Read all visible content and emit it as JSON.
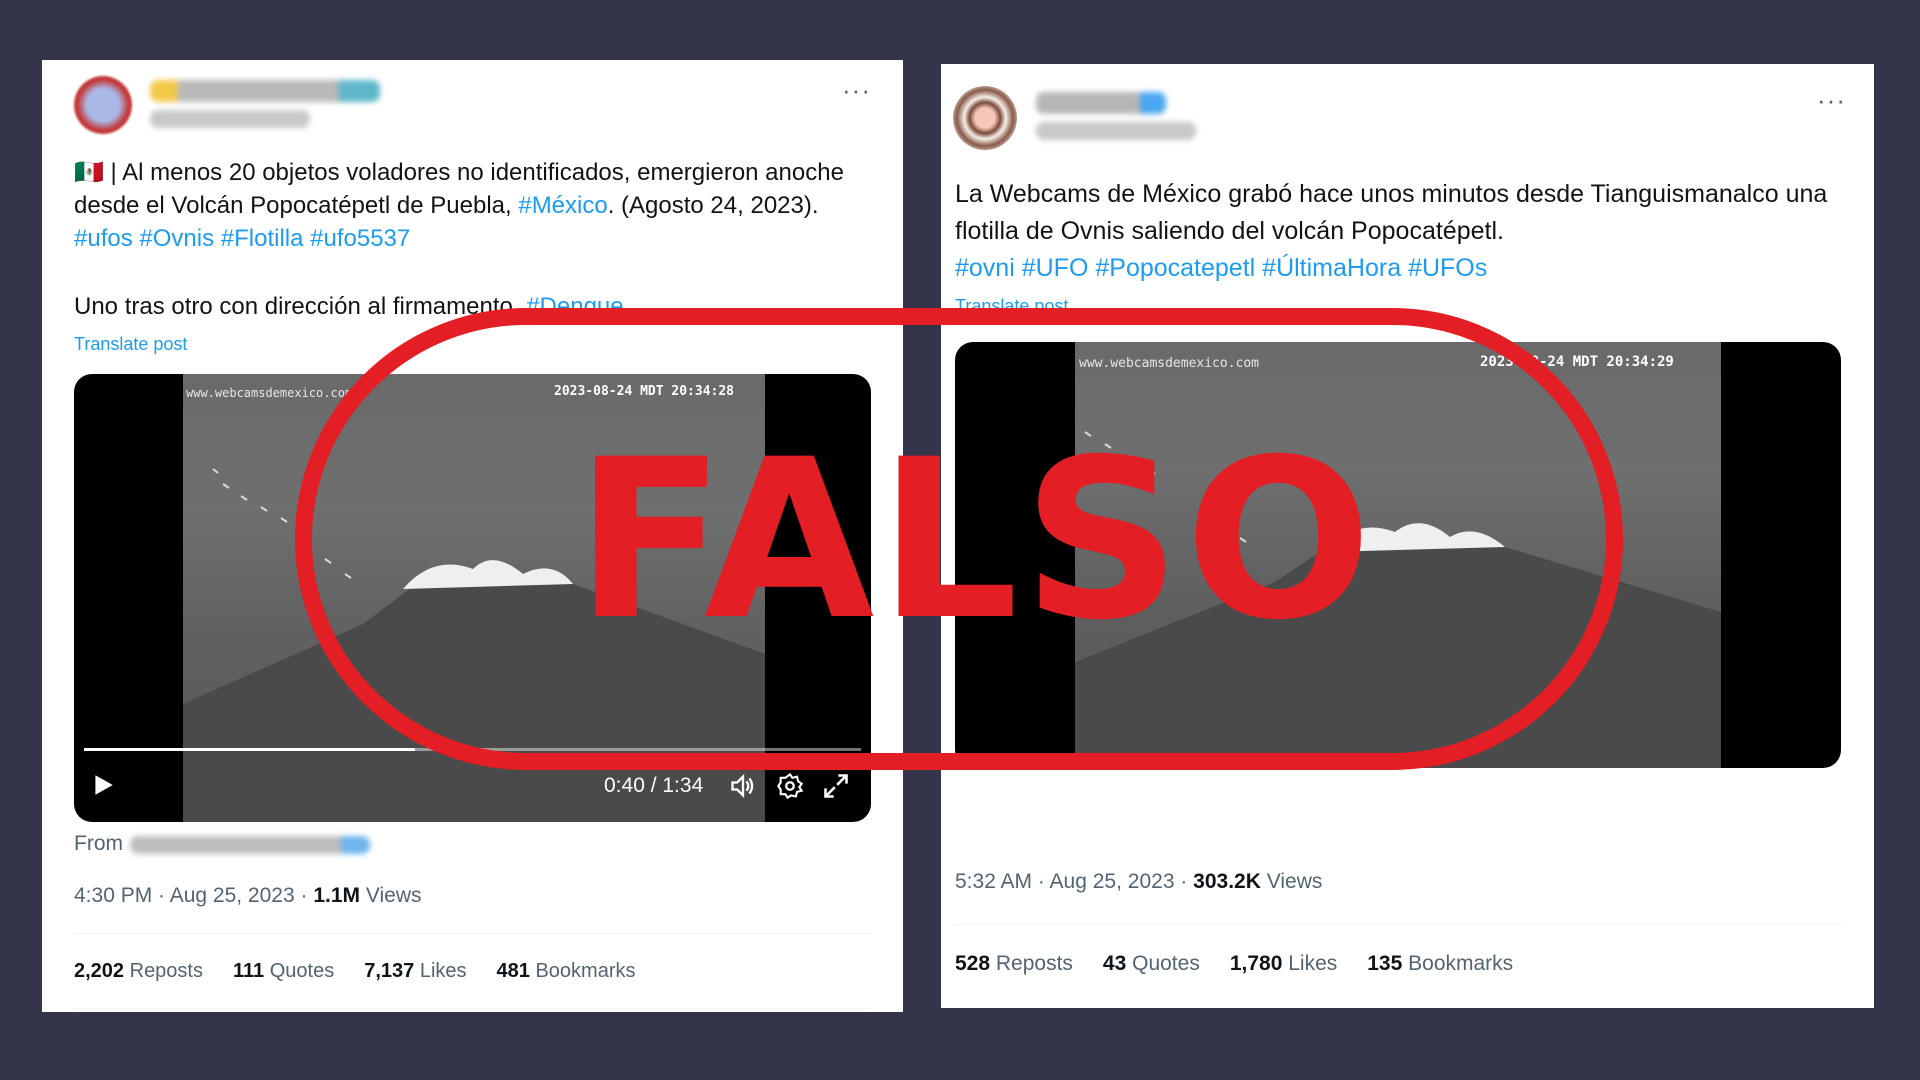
{
  "tweet_left": {
    "flag": "🇲🇽",
    "text_main": " | Al menos 20 objetos voladores no identificados, emergieron anoche desde el Volcán Popocatépetl de Puebla, ",
    "tag_mexico": "#México",
    "text_date": ". (Agosto 24, 2023).",
    "tag_ufos": "#ufos",
    "tag_ovnis": "#Ovnis",
    "tag_flotilla": "#Flotilla",
    "tag_ufo5537": "#ufo5537",
    "line2": "Uno tras otro con dirección al firmamento.",
    "tag_partial": "#Dengue",
    "translate": "Translate post",
    "video": {
      "watermark": "www.webcamsdemexico.com",
      "timestamp": "2023-08-24 MDT 20:34:28",
      "time": "0:40 / 1:34",
      "progress": 0.426
    },
    "from_label": "From",
    "time_text": "4:30 PM · Aug 25, 2023 · ",
    "views_count": "1.1M",
    "views_label": " Views",
    "stats": [
      {
        "n": "2,202",
        "l": " Reposts"
      },
      {
        "n": "111",
        "l": " Quotes"
      },
      {
        "n": "7,137",
        "l": " Likes"
      },
      {
        "n": "481",
        "l": " Bookmarks"
      }
    ]
  },
  "tweet_right": {
    "text": "La Webcams de México grabó hace unos minutos desde Tianguismanalco una flotilla de Ovnis saliendo del volcán Popocatépetl.",
    "tag_ovni": "#ovni",
    "tag_ufo": "#UFO",
    "tag_popo": "#Popocatepetl",
    "tag_ultima": "#ÚltimaHora",
    "tag_ufos": "#UFOs",
    "translate": "Translate post",
    "video": {
      "watermark": "www.webcamsdemexico.com",
      "timestamp": "2023-08-24 MDT 20:34:29"
    },
    "time_text": "5:32 AM · Aug 25, 2023 · ",
    "views_count": "303.2K",
    "views_label": " Views",
    "stats": [
      {
        "n": "528",
        "l": " Reposts"
      },
      {
        "n": "43",
        "l": " Quotes"
      },
      {
        "n": "1,780",
        "l": " Likes"
      },
      {
        "n": "135",
        "l": " Bookmarks"
      }
    ]
  },
  "more_icon": "···",
  "stamp_text": "FALSO",
  "colors": {
    "stamp": "#e31e24",
    "link": "#1d9bf0",
    "background": "#34344a"
  }
}
